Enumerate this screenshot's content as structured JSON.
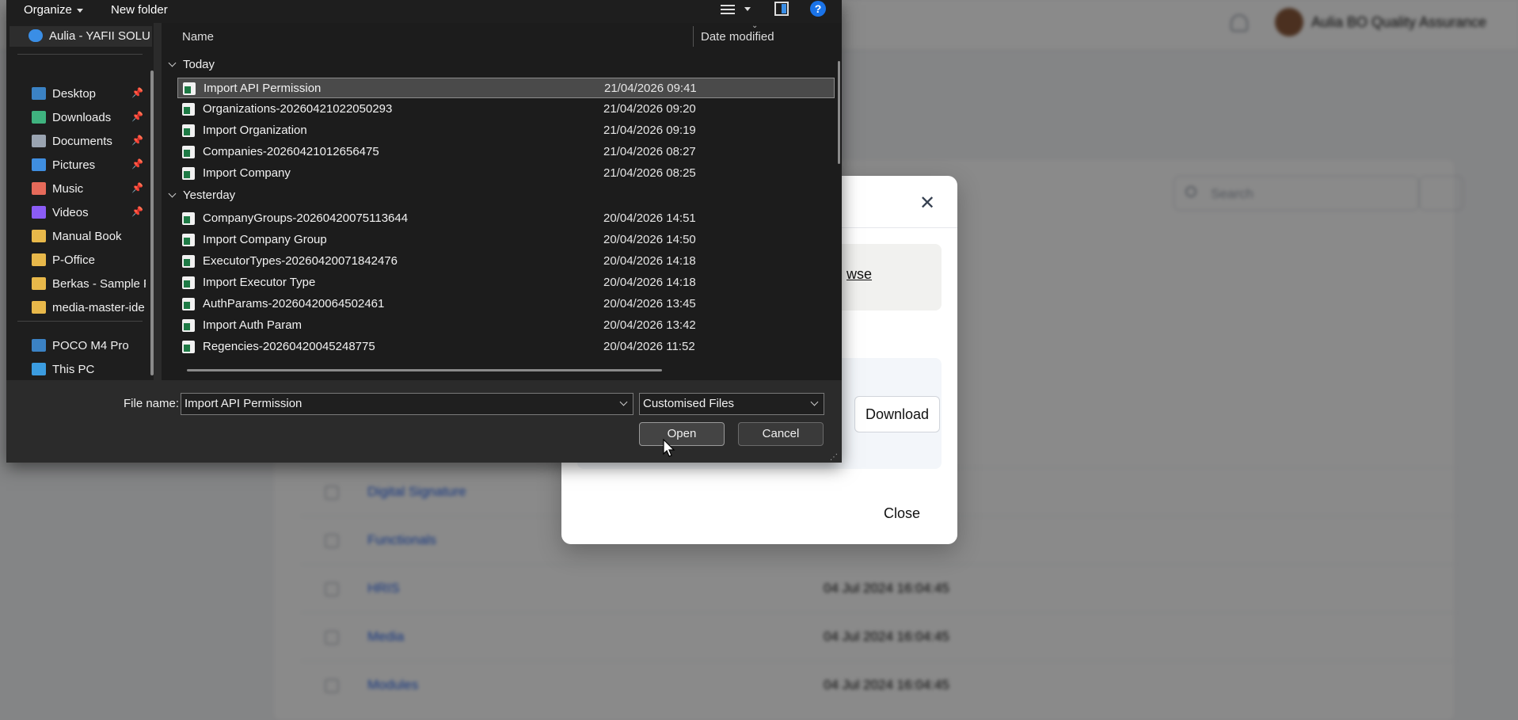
{
  "background": {
    "user_name": "Aulia BO Quality Assurance",
    "search_placeholder": "Search",
    "rows": [
      {
        "name": "Digital Signature",
        "date": ""
      },
      {
        "name": "Functionals",
        "date": ""
      },
      {
        "name": "HRIS",
        "date": "04 Jul 2024 16:04:45"
      },
      {
        "name": "Media",
        "date": "04 Jul 2024 16:04:45"
      },
      {
        "name": "Modules",
        "date": "04 Jul 2024 16:04:45"
      }
    ]
  },
  "modal": {
    "browse_label": "wse",
    "download_label": "Download",
    "close_label": "Close"
  },
  "dialog": {
    "toolbar": {
      "organize": "Organize",
      "new_folder": "New folder",
      "help": "?"
    },
    "nav": {
      "top_item": "Aulia - YAFII SOLU",
      "items": [
        {
          "label": "Desktop",
          "icon": "desktop-icon",
          "pinned": true,
          "color": "#3b82c4"
        },
        {
          "label": "Downloads",
          "icon": "downloads-icon",
          "pinned": true,
          "color": "#3fb37f"
        },
        {
          "label": "Documents",
          "icon": "documents-icon",
          "pinned": true,
          "color": "#9aa4b1"
        },
        {
          "label": "Pictures",
          "icon": "pictures-icon",
          "pinned": true,
          "color": "#3f8ee0"
        },
        {
          "label": "Music",
          "icon": "music-icon",
          "pinned": true,
          "color": "#e66a5a"
        },
        {
          "label": "Videos",
          "icon": "videos-icon",
          "pinned": true,
          "color": "#8b5cf6"
        },
        {
          "label": "Manual Book",
          "icon": "folder-icon",
          "pinned": false,
          "color": "#e8b84a"
        },
        {
          "label": "P-Office",
          "icon": "folder-icon",
          "pinned": false,
          "color": "#e8b84a"
        },
        {
          "label": "Berkas - Sample F",
          "icon": "folder-icon",
          "pinned": false,
          "color": "#e8b84a"
        },
        {
          "label": "media-master-ide",
          "icon": "folder-icon",
          "pinned": false,
          "color": "#e8b84a"
        }
      ],
      "devices": [
        {
          "label": "POCO M4 Pro",
          "icon": "phone-icon",
          "color": "#3b82c4"
        },
        {
          "label": "This PC",
          "icon": "computer-icon",
          "color": "#3b9ce0"
        }
      ]
    },
    "columns": {
      "name": "Name",
      "date": "Date modified"
    },
    "groups": [
      {
        "label": "Today",
        "files": [
          {
            "name": "Import API Permission",
            "date": "21/04/2026 09:41",
            "selected": true
          },
          {
            "name": "Organizations-20260421022050293",
            "date": "21/04/2026 09:20"
          },
          {
            "name": "Import Organization",
            "date": "21/04/2026 09:19"
          },
          {
            "name": "Companies-20260421012656475",
            "date": "21/04/2026 08:27"
          },
          {
            "name": "Import Company",
            "date": "21/04/2026 08:25"
          }
        ]
      },
      {
        "label": "Yesterday",
        "files": [
          {
            "name": "CompanyGroups-20260420075113644",
            "date": "20/04/2026 14:51"
          },
          {
            "name": "Import Company Group",
            "date": "20/04/2026 14:50"
          },
          {
            "name": "ExecutorTypes-20260420071842476",
            "date": "20/04/2026 14:18"
          },
          {
            "name": "Import Executor Type",
            "date": "20/04/2026 14:18"
          },
          {
            "name": "AuthParams-20260420064502461",
            "date": "20/04/2026 13:45"
          },
          {
            "name": "Import Auth Param",
            "date": "20/04/2026 13:42"
          },
          {
            "name": "Regencies-20260420045248775",
            "date": "20/04/2026 11:52"
          }
        ]
      }
    ],
    "file_name_label": "File name:",
    "file_name_value": "Import API Permission",
    "file_type_value": "Customised Files",
    "open_label": "Open",
    "cancel_label": "Cancel"
  }
}
